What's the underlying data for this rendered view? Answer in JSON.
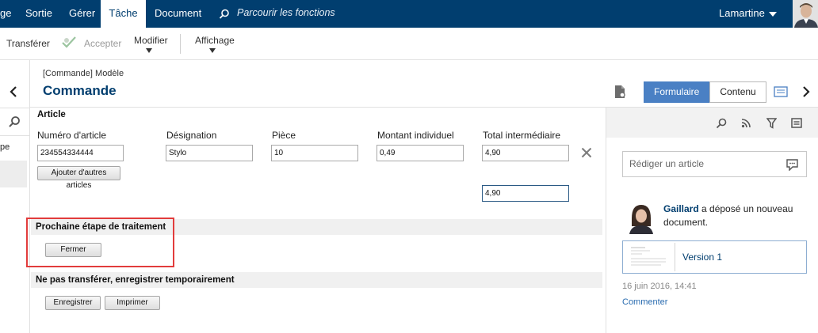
{
  "nav": {
    "items": [
      {
        "label": "ge"
      },
      {
        "label": "Sortie"
      },
      {
        "label": "Gérer"
      },
      {
        "label": "Tâche"
      },
      {
        "label": "Document"
      }
    ],
    "search_label": "Parcourir les fonctions",
    "user_name": "Lamartine"
  },
  "toolbar": {
    "transfer": "Transférer",
    "accept": "Accepter",
    "modify": "Modifier",
    "view": "Affichage"
  },
  "header": {
    "breadcrumb": "[Commande] Modèle",
    "title": "Commande",
    "tab_form": "Formulaire",
    "tab_content": "Contenu"
  },
  "left_strip": {
    "fragment": "pe"
  },
  "article": {
    "section_title": "Article",
    "columns": [
      "Numéro d'article",
      "Désignation",
      "Pièce",
      "Montant individuel",
      "Total intermédiaire"
    ],
    "row": {
      "number": "234554334444",
      "designation": "Stylo",
      "pieces": "10",
      "unit_amount": "0,49",
      "subtotal": "4,90"
    },
    "add_button": "Ajouter d'autres articles",
    "total": "4,90"
  },
  "next_step": {
    "title": "Prochaine étape de traitement",
    "close_button": "Fermer"
  },
  "save_section": {
    "title": "Ne pas transférer, enregistrer temporairement",
    "save_button": "Enregistrer",
    "print_button": "Imprimer"
  },
  "feed": {
    "input_placeholder": "Rédiger un article",
    "author": "Gaillard",
    "action": " a déposé un nouveau document.",
    "doc_label": "Version 1",
    "timestamp": "16 juin 2016, 14:41",
    "comment": "Commenter"
  },
  "colors": {
    "nav_bg": "#013e6f",
    "accent": "#4a80c4",
    "highlight": "#e23c3c"
  }
}
